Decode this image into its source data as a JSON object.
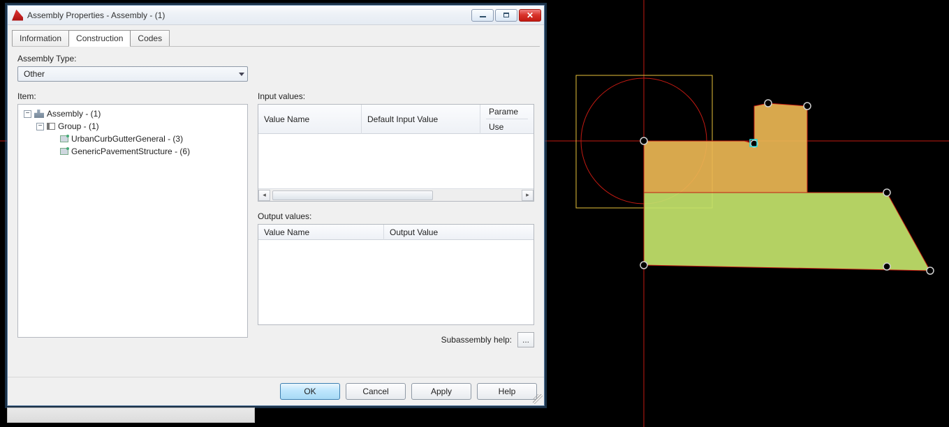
{
  "window": {
    "title": "Assembly Properties - Assembly - (1)"
  },
  "tabs": {
    "items": [
      {
        "label": "Information",
        "active": false
      },
      {
        "label": "Construction",
        "active": true
      },
      {
        "label": "Codes",
        "active": false
      }
    ]
  },
  "assemblyType": {
    "label": "Assembly Type:",
    "value": "Other"
  },
  "itemSection": {
    "label": "Item:",
    "tree": {
      "root": {
        "label": "Assembly - (1)"
      },
      "group": {
        "label": "Group - (1)"
      },
      "sub1": {
        "label": "UrbanCurbGutterGeneral - (3)"
      },
      "sub2": {
        "label": "GenericPavementStructure - (6)"
      }
    }
  },
  "inputValues": {
    "label": "Input values:",
    "headers": {
      "valueName": "Value Name",
      "defaultInputValue": "Default Input Value",
      "parameterGroup": "Parame",
      "use": "Use"
    }
  },
  "outputValues": {
    "label": "Output values:",
    "headers": {
      "valueName": "Value Name",
      "outputValue": "Output Value"
    }
  },
  "subassemblyHelp": {
    "label": "Subassembly help:",
    "buttonLabel": "..."
  },
  "buttons": {
    "ok": "OK",
    "cancel": "Cancel",
    "apply": "Apply",
    "help": "Help"
  },
  "glyphs": {
    "minus": "−",
    "leftTri": "◂",
    "rightTri": "▸",
    "x": "✕"
  }
}
